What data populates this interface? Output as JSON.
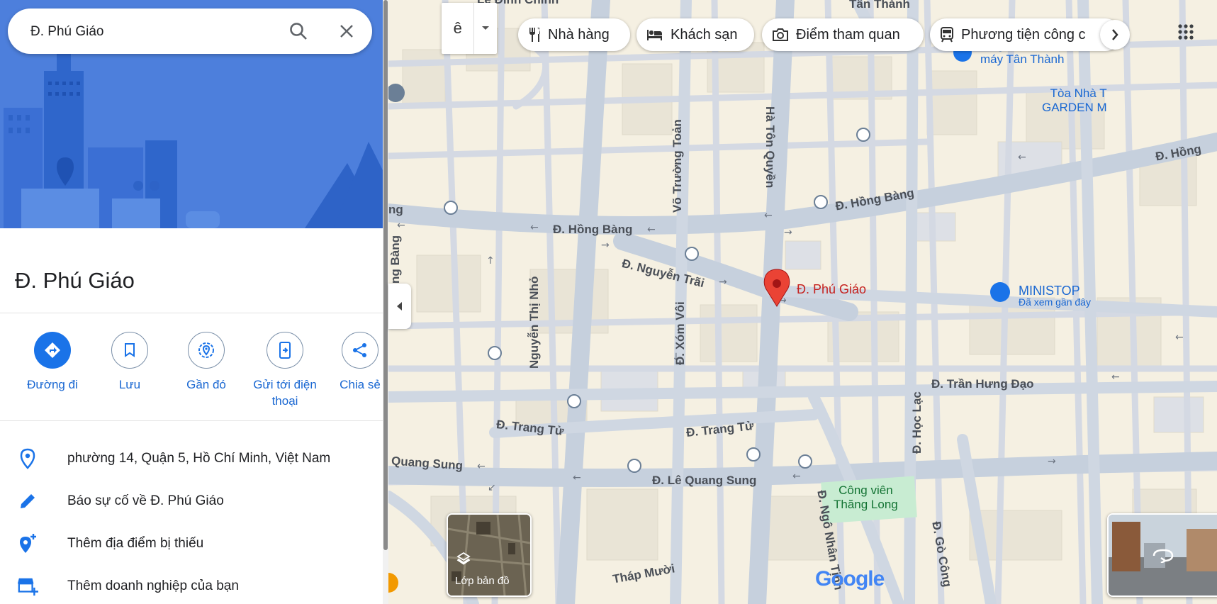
{
  "search": {
    "query": "Đ. Phú Giáo"
  },
  "place": {
    "title": "Đ. Phú Giáo"
  },
  "actions": [
    {
      "label": "Đường đi"
    },
    {
      "label": "Lưu"
    },
    {
      "label": "Gần đó"
    },
    {
      "label": "Gửi tới điện thoại"
    },
    {
      "label": "Chia sẻ"
    }
  ],
  "info": {
    "address": "phường 14, Quận 5, Hồ Chí Minh, Việt Nam",
    "report": "Báo sự cố về Đ. Phú Giáo",
    "add_place": "Thêm địa điểm bị thiếu",
    "add_business": "Thêm doanh nghiệp của bạn"
  },
  "map": {
    "input_tool": "ê",
    "chips": [
      {
        "label": "Nhà hàng",
        "icon": "restaurant-icon"
      },
      {
        "label": "Khách sạn",
        "icon": "hotel-icon"
      },
      {
        "label": "Điểm tham quan",
        "icon": "camera-icon"
      },
      {
        "label": "Phương tiện công c",
        "icon": "transit-icon"
      }
    ],
    "layers_label": "Lớp bản đồ",
    "logo": "Google",
    "pin_label": "Đ. Phú Giáo",
    "labels": {
      "hong_bang_1": "Đ. Hồng Bàng",
      "hong_bang_2": "Đ. Hồng Bàng",
      "hong_bang_3": "Đ. Hồng",
      "nguyen_trai": "Đ. Nguyễn Trãi",
      "tran_hung_dao": "Đ. Trần Hưng Đạo",
      "trang_tu_1": "Đ. Trang Tử",
      "trang_tu_2": "Đ. Trang Tử",
      "le_quang_sung": "Đ. Lê Quang Sung",
      "quang_sung": "Quang Sung",
      "thap_muoi": "Tháp Mười",
      "nguyen_thi_nho": "Nguyễn Thị Nhỏ",
      "xom_voi": "Đ. Xóm Vôi",
      "vo_truong_toan": "Võ Trường Toản",
      "ha_ton_quyen": "Hà Tôn Quyền",
      "hoc_lac": "Đ. Học Lạc",
      "ngo_nhan_tinh": "Đ. Ngô Nhân Tịnh",
      "go_cong": "Đ. Gò Công",
      "ng": "ng",
      "ng_bang": "ng Bàng",
      "le_dinh_chinh": "Lê Đình Chính",
      "tan_thanh": "Tân Thành",
      "tan_thanh_shop": "tùng xe\nmáy Tân Thành",
      "garden": "Tòa Nhà T\nGARDEN M",
      "ministop": "MINISTOP",
      "ministop_sub": "Đã xem gần đây",
      "park": "Công viên\nThăng Long"
    }
  }
}
